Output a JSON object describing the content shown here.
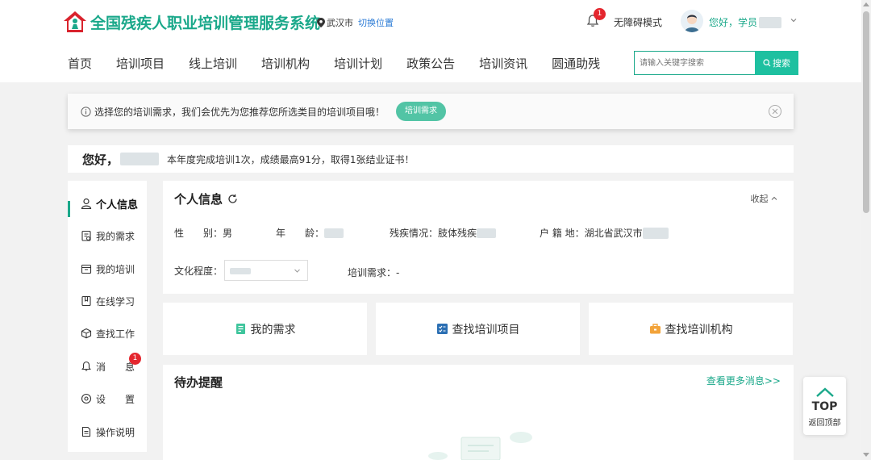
{
  "header": {
    "site_title": "全国残疾人职业培训管理服务系统",
    "location": "武汉市",
    "switch_location": "切换位置",
    "notification_count": "1",
    "accessibility_mode": "无障碍模式",
    "greeting": "您好，学员"
  },
  "nav": {
    "items": [
      "首页",
      "培训项目",
      "线上培训",
      "培训机构",
      "培训计划",
      "政策公告",
      "培训资讯",
      "圆通助残"
    ],
    "search_placeholder": "请输入关键字搜索",
    "search_button": "搜索"
  },
  "notice": {
    "text": "选择您的培训需求，我们会优先为您推荐您所选类目的培训项目哦！",
    "button": "培训需求"
  },
  "hello": {
    "prefix": "您好，",
    "summary": "本年度完成培训1次，成绩最高91分，取得1张结业证书！"
  },
  "sidebar": {
    "items": [
      "个人信息",
      "我的需求",
      "我的培训",
      "在线学习",
      "查找工作",
      "消　　息",
      "设　　置",
      "操作说明"
    ],
    "message_badge": "1"
  },
  "profile": {
    "title": "个人信息",
    "collapse": "收起",
    "gender_label": "性　　别：",
    "gender_value": "男",
    "age_label": "年　　龄：",
    "disability_label": "残疾情况：",
    "disability_value": "肢体残疾",
    "household_label": "户  籍  地：",
    "household_value": "湖北省武汉市",
    "education_label": "文化程度：",
    "demand_label": "培训需求：",
    "demand_value": "-"
  },
  "cards": [
    "我的需求",
    "查找培训项目",
    "查找培训机构"
  ],
  "todo": {
    "title": "待办提醒",
    "more": "查看更多消息>>"
  },
  "back_top": {
    "top": "TOP",
    "label": "返回顶部"
  },
  "colors": {
    "brand": "#1aa88a",
    "accent": "#1ec0a0",
    "badge": "#e4262e",
    "link": "#2b7bd6"
  }
}
